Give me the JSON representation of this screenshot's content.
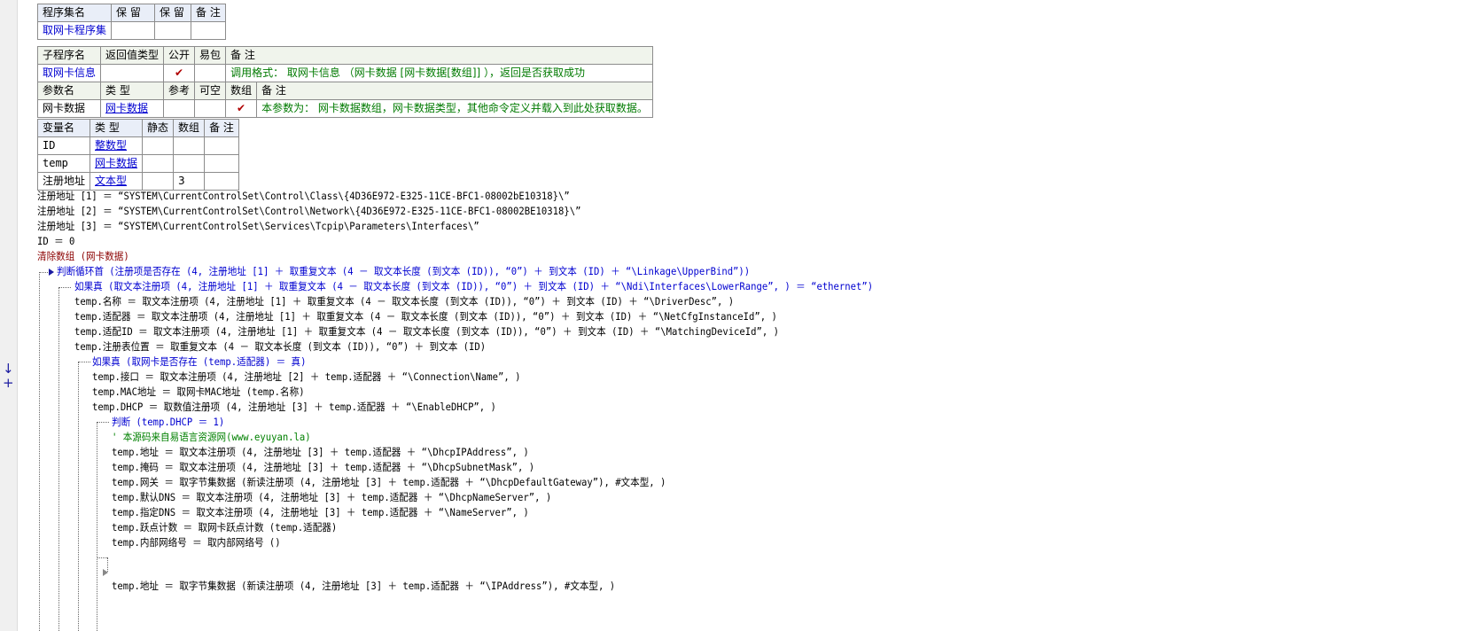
{
  "gutter": {
    "marks": "↓ +"
  },
  "assembly_table": {
    "headers": [
      "程序集名",
      "保 留",
      "保 留",
      "备 注"
    ],
    "row": [
      "取网卡程序集",
      "",
      "",
      ""
    ]
  },
  "sub_table": {
    "headers": [
      "子程序名",
      "返回值类型",
      "公开",
      "易包",
      "备 注"
    ],
    "row": {
      "name": "取网卡信息",
      "ret": "",
      "public": "✔",
      "epkg": "",
      "note": "调用格式： 取网卡信息 （网卡数据 [网卡数据[数组]] ），返回是否获取成功"
    },
    "param_headers": [
      "参数名",
      "类 型",
      "参考",
      "可空",
      "数组",
      "备 注"
    ],
    "param_row": {
      "name": "网卡数据",
      "type": "网卡数据",
      "ref": "",
      "nullable": "",
      "array": "✔",
      "note": "本参数为： 网卡数据数组，网卡数据类型，其他命令定义并载入到此处获取数据。"
    }
  },
  "var_table": {
    "headers": [
      "变量名",
      "类 型",
      "静态",
      "数组",
      "备 注"
    ],
    "rows": [
      {
        "name": "ID",
        "type": "整数型",
        "static": "",
        "array": "",
        "note": ""
      },
      {
        "name": "temp",
        "type": "网卡数据",
        "static": "",
        "array": "",
        "note": ""
      },
      {
        "name": "注册地址",
        "type": "文本型",
        "static": "",
        "array": "3",
        "note": ""
      }
    ]
  },
  "code_lines": [
    "注册地址 [1] ＝ “SYSTEM\\CurrentControlSet\\Control\\Class\\{4D36E972-E325-11CE-BFC1-08002bE10318}\\”",
    "注册地址 [2] ＝ “SYSTEM\\CurrentControlSet\\Control\\Network\\{4D36E972-E325-11CE-BFC1-08002BE10318}\\”",
    "注册地址 [3] ＝ “SYSTEM\\CurrentControlSet\\Services\\Tcpip\\Parameters\\Interfaces\\”",
    "ID ＝ 0",
    "清除数组 (网卡数据)",
    "判断循环首 (注册项是否存在 (4, 注册地址 [1] ＋ 取重复文本 (4 － 取文本长度 (到文本 (ID)), “0”) ＋ 到文本 (ID) ＋ “\\Linkage\\UpperBind”))",
    "如果真 (取文本注册项 (4, 注册地址 [1] ＋ 取重复文本 (4 － 取文本长度 (到文本 (ID)), “0”) ＋ 到文本 (ID) ＋ “\\Ndi\\Interfaces\\LowerRange”, ) ＝ “ethernet”)",
    "temp.名称 ＝ 取文本注册项 (4, 注册地址 [1] ＋ 取重复文本 (4 － 取文本长度 (到文本 (ID)), “0”) ＋ 到文本 (ID) ＋ “\\DriverDesc”, )",
    "temp.适配器 ＝ 取文本注册项 (4, 注册地址 [1] ＋ 取重复文本 (4 － 取文本长度 (到文本 (ID)), “0”) ＋ 到文本 (ID) ＋ “\\NetCfgInstanceId”, )",
    "temp.适配ID ＝ 取文本注册项 (4, 注册地址 [1] ＋ 取重复文本 (4 － 取文本长度 (到文本 (ID)), “0”) ＋ 到文本 (ID) ＋ “\\MatchingDeviceId”, )",
    "temp.注册表位置 ＝ 取重复文本 (4 － 取文本长度 (到文本 (ID)), “0”) ＋ 到文本 (ID)",
    "如果真 (取网卡是否存在 (temp.适配器) ＝ 真)",
    "temp.接口 ＝ 取文本注册项 (4, 注册地址 [2] ＋ temp.适配器 ＋ “\\Connection\\Name”, )",
    "temp.MAC地址 ＝ 取网卡MAC地址 (temp.名称)",
    "temp.DHCP ＝ 取数值注册项 (4, 注册地址 [3] ＋ temp.适配器 ＋ “\\EnableDHCP”, )",
    "判断 (temp.DHCP ＝ 1)",
    "' 本源码来自易语言资源网(www.eyuyan.la)",
    "temp.地址 ＝ 取文本注册项 (4, 注册地址 [3] ＋ temp.适配器 ＋ “\\DhcpIPAddress”, )",
    "temp.掩码 ＝ 取文本注册项 (4, 注册地址 [3] ＋ temp.适配器 ＋ “\\DhcpSubnetMask”, )",
    "temp.网关 ＝ 取字节集数据 (新读注册项 (4, 注册地址 [3] ＋ temp.适配器 ＋ “\\DhcpDefaultGateway”), #文本型, )",
    "temp.默认DNS ＝ 取文本注册项 (4, 注册地址 [3] ＋ temp.适配器 ＋ “\\DhcpNameServer”, )",
    "temp.指定DNS ＝ 取文本注册项 (4, 注册地址 [3] ＋ temp.适配器 ＋ “\\NameServer”, )",
    "temp.跃点计数 ＝ 取网卡跃点计数 (temp.适配器)",
    "temp.内部网络号 ＝ 取内部网络号 ()",
    "temp.地址 ＝ 取字节集数据 (新读注册项 (4, 注册地址 [3] ＋ temp.适配器 ＋ “\\IPAddress”), #文本型, )"
  ]
}
